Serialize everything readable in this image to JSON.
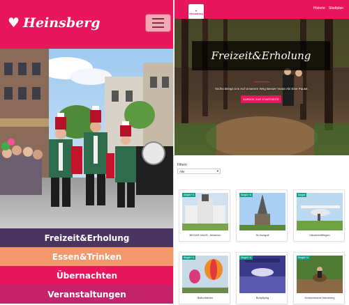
{
  "mobile": {
    "brand": "Heinsberg",
    "nav": [
      {
        "label": "Freizeit&Erholung",
        "color": "#4a3561"
      },
      {
        "label": "Essen&Trinken",
        "color": "#f2986a"
      },
      {
        "label": "Übernachten",
        "color": "#e8175d"
      },
      {
        "label": "Veranstaltungen",
        "color": "#c4236a"
      }
    ]
  },
  "desktop": {
    "logo_text": "Heinsberg",
    "top_links": [
      "Historie",
      "Stadtplan"
    ],
    "hero": {
      "title": "Freizeit&Erholung",
      "subtitle": "Nichts Bringt Uns Auf Unserem Weg Besser Voran Als Eine Pause.",
      "button": "ZURÜCK ZUR STARTSEITE"
    },
    "filter": {
      "label": "Filtern",
      "value": "Alle"
    },
    "cards": [
      {
        "tag": "Sieght +3",
        "caption": "BEGAS HAUS - Museum"
      },
      {
        "tag": "Sieght +8",
        "caption": "St.Gangolf"
      },
      {
        "tag": "Sieght",
        "caption": "Ultraleichtfliegen"
      },
      {
        "tag": "Sieght +4",
        "caption": "Ballonfahren"
      },
      {
        "tag": "Sieght +4",
        "caption": "Bodyflying"
      },
      {
        "tag": "Sieght +4",
        "caption": "Kreisverband Heinsberg"
      }
    ]
  },
  "colors": {
    "brand": "#e8175d",
    "tag": "#12a08a"
  }
}
